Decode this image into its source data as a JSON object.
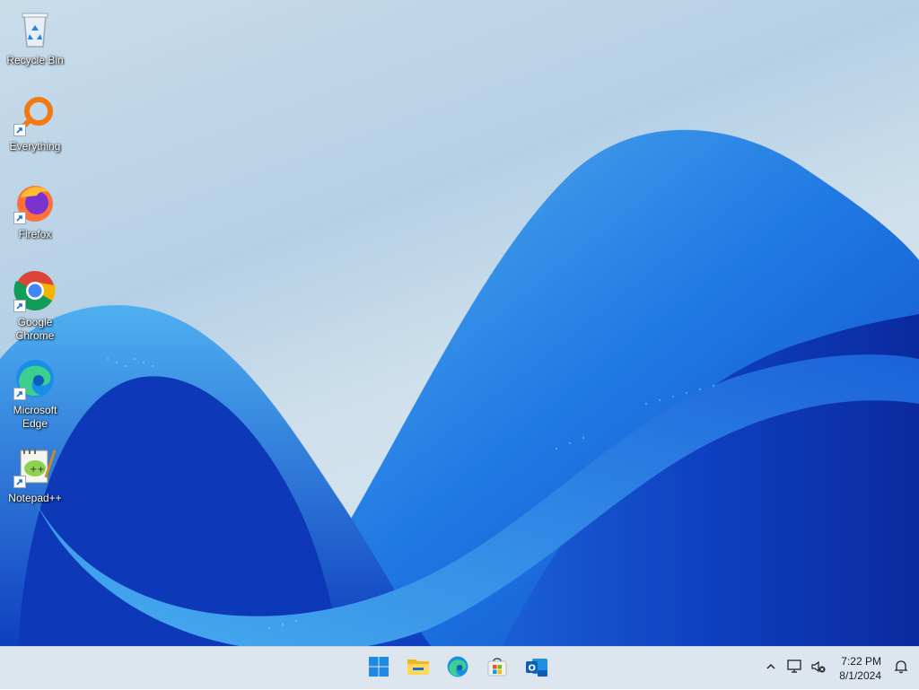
{
  "desktop": {
    "icons": [
      {
        "label": "Recycle Bin",
        "icon": "recycle-bin-icon"
      },
      {
        "label": "Everything",
        "icon": "everything-search-icon"
      },
      {
        "label": "Firefox",
        "icon": "firefox-icon"
      },
      {
        "label": "Google Chrome",
        "icon": "chrome-icon"
      },
      {
        "label": "Microsoft Edge",
        "icon": "edge-icon"
      },
      {
        "label": "Notepad++",
        "icon": "notepadpp-icon"
      }
    ]
  },
  "taskbar": {
    "pinned": [
      {
        "name": "Start",
        "icon": "windows-start-icon"
      },
      {
        "name": "File Explorer",
        "icon": "folder-icon"
      },
      {
        "name": "Microsoft Edge",
        "icon": "edge-icon"
      },
      {
        "name": "Microsoft Store",
        "icon": "store-icon"
      },
      {
        "name": "Outlook (new)",
        "icon": "outlook-icon"
      }
    ],
    "tray": {
      "time": "7:22 PM",
      "date": "8/1/2024"
    }
  },
  "colors": {
    "wallpaper_deep": "#0a2fb8",
    "wallpaper_mid": "#1e6fe0",
    "wallpaper_light": "#4aa7ee",
    "taskbar_bg": "#dde6ef"
  }
}
